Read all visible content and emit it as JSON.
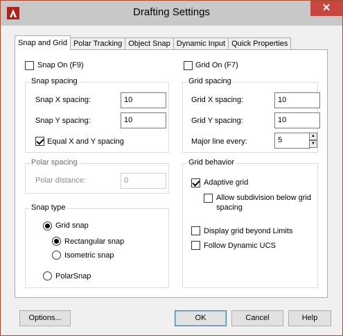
{
  "window": {
    "title": "Drafting Settings",
    "close_glyph": "✕",
    "accent": "#c7463f"
  },
  "tabs": [
    "Snap and Grid",
    "Polar Tracking",
    "Object Snap",
    "Dynamic Input",
    "Quick Properties"
  ],
  "active_tab": 0,
  "snap_on": {
    "label": "Snap On (F9)",
    "checked": false
  },
  "grid_on": {
    "label": "Grid On (F7)",
    "checked": false
  },
  "snap_spacing": {
    "title": "Snap spacing",
    "x_label": "Snap X spacing:",
    "x_value": "10",
    "y_label": "Snap Y spacing:",
    "y_value": "10",
    "equal_label": "Equal X and Y spacing",
    "equal_checked": true
  },
  "grid_spacing": {
    "title": "Grid spacing",
    "x_label": "Grid X spacing:",
    "x_value": "10",
    "y_label": "Grid Y spacing:",
    "y_value": "10",
    "major_label": "Major line every:",
    "major_value": "5"
  },
  "polar_spacing": {
    "title": "Polar spacing",
    "distance_label": "Polar distance:",
    "distance_value": "0"
  },
  "snap_type": {
    "title": "Snap type",
    "grid_snap": "Grid snap",
    "rectangular": "Rectangular snap",
    "isometric": "Isometric snap",
    "polar_snap": "PolarSnap"
  },
  "grid_behavior": {
    "title": "Grid behavior",
    "adaptive": "Adaptive grid",
    "subdivision_line1": "Allow subdivision below grid",
    "subdivision_line2": "spacing",
    "beyond_limits": "Display grid beyond Limits",
    "follow_ucs": "Follow Dynamic UCS"
  },
  "buttons": {
    "options": "Options...",
    "ok": "OK",
    "cancel": "Cancel",
    "help": "Help"
  }
}
